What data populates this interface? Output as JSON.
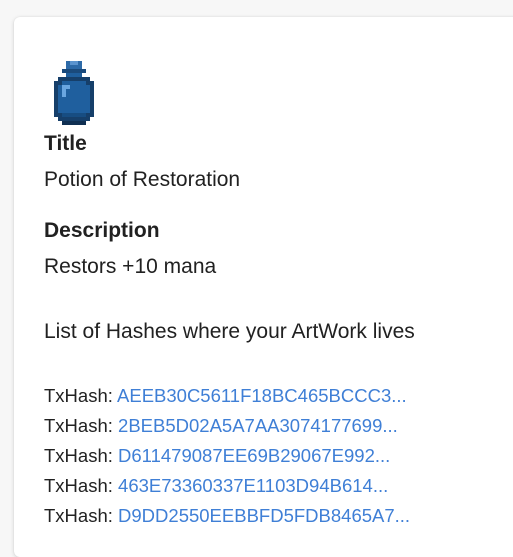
{
  "item": {
    "icon": "potion-bottle-icon",
    "title_label": "Title",
    "title_value": "Potion of Restoration",
    "description_label": "Description",
    "description_value": "Restors +10 mana"
  },
  "hashes": {
    "heading": "List of Hashes where your ArtWork lives",
    "prefix": "TxHash:",
    "items": [
      "AEEB30C5611F18BC465BCCC3...",
      "2BEB5D02A5A7AA3074177699...",
      "D611479087EE69B29067E992...",
      "463E73360337E1103D94B614...",
      "D9DD2550EEBBFD5FDB8465A7..."
    ]
  },
  "colors": {
    "link": "#3f7fd6",
    "potion_blue": "#1f5f9e"
  }
}
